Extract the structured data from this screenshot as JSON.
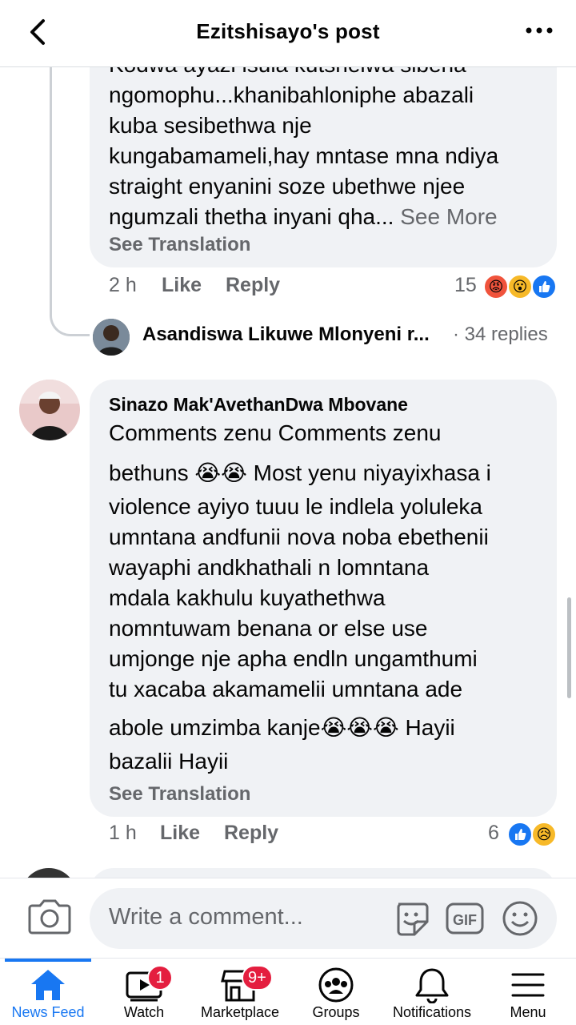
{
  "header": {
    "title": "Ezitshisayo's post"
  },
  "comment1": {
    "partial_top_line": "Kodwa ayazi isula kutshelwa sibena",
    "text": "ngomophu...khanibahloniphe abazali\nkuba sesibethwa nje\nkungabamameli,hay mntase mna ndiya\nstraight enyanini soze ubethwe njee\nngumzali thetha inyani qha... ",
    "see_more": "See More",
    "see_translation": "See Translation",
    "time": "2 h",
    "like": "Like",
    "reply": "Reply",
    "reaction_count": "15",
    "reactions": [
      "angry",
      "wow",
      "like"
    ]
  },
  "reply_preview": {
    "author": "Asandiswa Likuwe Mlonyeni r...",
    "replies": "· 34 replies"
  },
  "comment2": {
    "author": "Sinazo Mak'AvethanDwa Mbovane",
    "line1": "Comments zenu Comments zenu",
    "line2": "bethuns 😭😭 Most yenu niyayixhasa i",
    "line3": "violence ayiyo tuuu le indlela yoluleka\numntana andfunii nova noba ebethenii\nwayaphi  andkhathali n lomntana\nmdala kakhulu kuyathethwa\nnomntuwam benana or else use\numjonge nje apha endln ungamthumi\ntu xacaba akamamelii umntana ade",
    "line4": "abole umzimba kanje😭😭😭  Hayii",
    "line5": "bazalii Hayii",
    "see_translation": "See Translation",
    "time": "1 h",
    "like": "Like",
    "reply": "Reply",
    "reaction_count": "6",
    "reactions": [
      "like",
      "sad"
    ]
  },
  "composer": {
    "placeholder": "Write a comment...",
    "gif_label": "GIF"
  },
  "nav": {
    "items": [
      {
        "label": "News Feed",
        "icon": "home-icon",
        "active": true
      },
      {
        "label": "Watch",
        "icon": "watch-icon",
        "badge": "1"
      },
      {
        "label": "Marketplace",
        "icon": "marketplace-icon",
        "badge": "9+"
      },
      {
        "label": "Groups",
        "icon": "groups-icon"
      },
      {
        "label": "Notifications",
        "icon": "bell-icon"
      },
      {
        "label": "Menu",
        "icon": "menu-icon"
      }
    ]
  },
  "colors": {
    "accent": "#1877f2",
    "bubble": "#f0f2f5",
    "secondary_text": "#65676b",
    "badge": "#e41e3f"
  }
}
